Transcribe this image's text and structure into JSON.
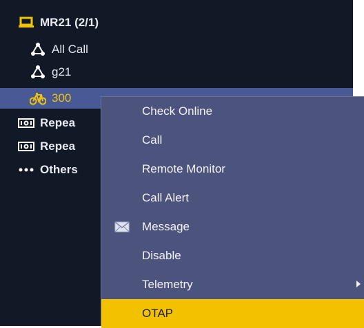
{
  "tree": {
    "radio_header": {
      "label": "MR21 (2/1)",
      "icon": "laptop-icon",
      "color": "#f0c20a"
    },
    "items": [
      {
        "label": "All Call",
        "icon": "group-icon"
      },
      {
        "label": "g21",
        "icon": "group-icon"
      },
      {
        "label": "300",
        "icon": "bicycle-icon",
        "selected": true
      },
      {
        "label": "Repea",
        "icon": "repeater-icon"
      },
      {
        "label": "Repea",
        "icon": "repeater-icon"
      },
      {
        "label": "Others",
        "icon": "ellipsis-icon"
      }
    ]
  },
  "context_menu": {
    "items": [
      {
        "label": "Check Online"
      },
      {
        "label": "Call"
      },
      {
        "label": "Remote Monitor"
      },
      {
        "label": "Call Alert"
      },
      {
        "label": "Message",
        "icon": "envelope-icon"
      },
      {
        "label": "Disable"
      },
      {
        "label": "Telemetry",
        "submenu": true
      },
      {
        "label": "OTAP",
        "highlighted": true
      }
    ],
    "highlight_color": "#f2c200"
  },
  "colors": {
    "panel_bg": "#121926",
    "selected_row_bg": "#475a96",
    "menu_bg": "#4c547e",
    "accent": "#f0c20a"
  }
}
